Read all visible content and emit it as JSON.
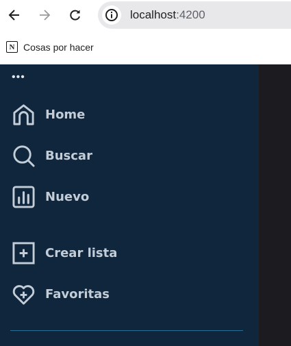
{
  "browser": {
    "url_host": "localhost",
    "url_port": ":4200",
    "bookmark": "Cosas por hacer",
    "bookmark_icon_letter": "N"
  },
  "sidebar": {
    "menu_dots": "•••",
    "items": [
      {
        "label": "Home",
        "icon": "home-icon"
      },
      {
        "label": "Buscar",
        "icon": "search-icon"
      },
      {
        "label": "Nuevo",
        "icon": "chart-icon"
      },
      {
        "label": "Crear lista",
        "icon": "plus-square-icon"
      },
      {
        "label": "Favoritas",
        "icon": "heart-plus-icon"
      }
    ]
  },
  "colors": {
    "sidebar": "#10263d",
    "text": "#c3cdd8",
    "divider": "#2b6e95",
    "content": "#1c1c20"
  }
}
